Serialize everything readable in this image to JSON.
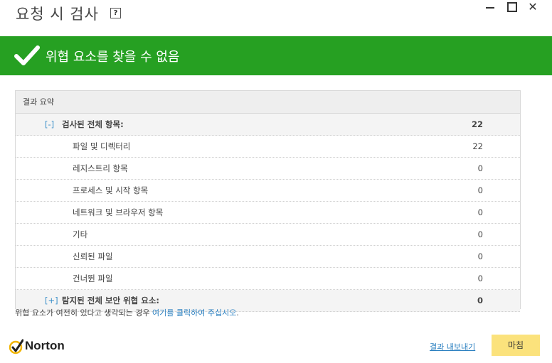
{
  "window": {
    "title": "요청 시 검사",
    "help": "?"
  },
  "banner": {
    "message": "위협 요소를 찾을 수 없음",
    "color": "#26a022"
  },
  "summary": {
    "header": "결과 요약",
    "rows": [
      {
        "toggle": "[-]",
        "label": "검사된 전체 항목:",
        "count": "22"
      },
      {
        "label": "파일 및 디렉터리",
        "count": "22"
      },
      {
        "label": "레지스트리 항목",
        "count": "0"
      },
      {
        "label": "프로세스 및 시작 항목",
        "count": "0"
      },
      {
        "label": "네트워크 및 브라우저 항목",
        "count": "0"
      },
      {
        "label": "기타",
        "count": "0"
      },
      {
        "label": "신뢰된 파일",
        "count": "0"
      },
      {
        "label": "건너뛴 파일",
        "count": "0"
      },
      {
        "toggle": "[+]",
        "label": "탐지된 전체 보안 위협 요소:",
        "count": "0"
      }
    ]
  },
  "note": {
    "prefix": "위협 요소가 여전히 있다고 생각되는 경우 ",
    "link": "여기를 클릭하여 주십시오",
    "suffix": "."
  },
  "footer": {
    "brand": "Norton",
    "export_link": "결과 내보내기",
    "done_button": "마침",
    "done_color": "#fbe27c"
  }
}
